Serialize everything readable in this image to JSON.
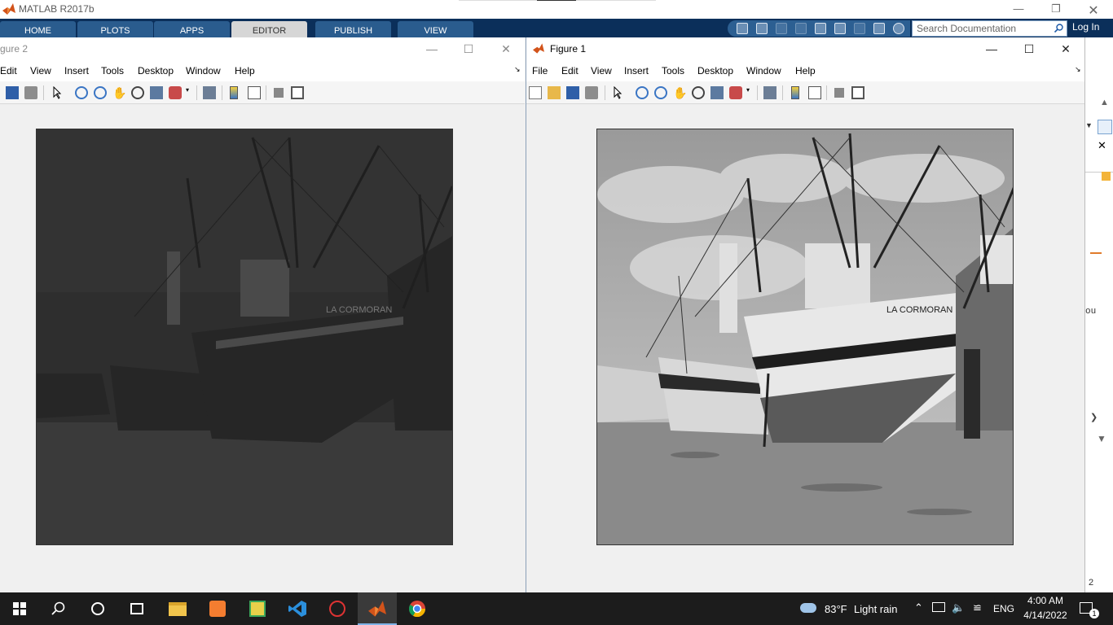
{
  "matlab": {
    "title": "MATLAB R2017b",
    "tabs": [
      "HOME",
      "PLOTS",
      "APPS",
      "EDITOR",
      "PUBLISH",
      "VIEW"
    ],
    "active_tab": "EDITOR",
    "search_placeholder": "Search Documentation",
    "login_label": "Log In",
    "side_text": "ou",
    "side_number": "2"
  },
  "figure2": {
    "title": "gure 2",
    "menus": [
      "Edit",
      "View",
      "Insert",
      "Tools",
      "Desktop",
      "Window",
      "Help"
    ],
    "image_desc": "darkened grayscale boats image"
  },
  "figure1": {
    "title": "Figure 1",
    "menus": [
      "File",
      "Edit",
      "View",
      "Insert",
      "Tools",
      "Desktop",
      "Window",
      "Help"
    ],
    "image_desc": "grayscale boats image"
  },
  "boat_lettering": "LA CORMORAN",
  "taskbar": {
    "weather_temp": "83°F",
    "weather_text": "Light rain",
    "lang": "ENG",
    "time": "4:00 AM",
    "date": "4/14/2022",
    "notif_count": "1"
  },
  "colors": {
    "ribbon_bg": "#0b2f5a",
    "tab_bg": "#2a5c8e",
    "taskbar_bg": "#1c1c1c"
  }
}
